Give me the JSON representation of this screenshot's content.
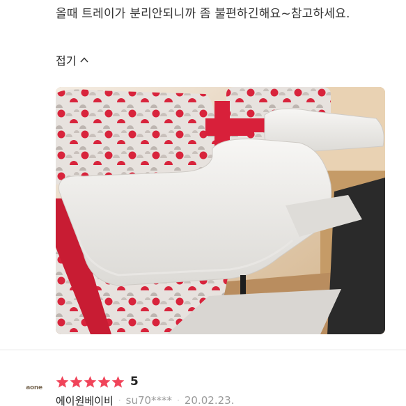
{
  "review": {
    "body": "올때 트레이가 분리안되니까 좀 불편하긴해요~참고하세요.",
    "collapse_label": "접기"
  },
  "next_review": {
    "avatar_text": "aone",
    "rating": "5",
    "stars_filled": 5,
    "stars_total": 5,
    "seller_name": "에이원베이비",
    "user_id": "su70****",
    "date": "20.02.23.",
    "separator": "·"
  },
  "colors": {
    "star": "#f0445a",
    "accent_red": "#d8203a",
    "muted_text": "#9a9a9a"
  },
  "icons": {
    "collapse": "chevron-up-icon",
    "star": "star-icon"
  }
}
